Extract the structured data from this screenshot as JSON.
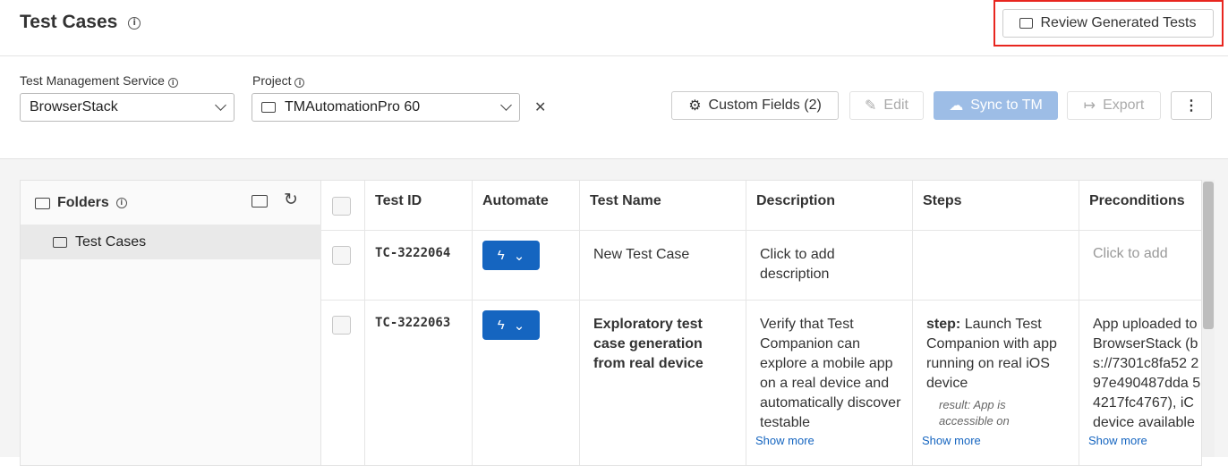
{
  "header": {
    "title": "Test Cases",
    "info_icon": "i",
    "review_button": "Review Generated Tests"
  },
  "filters": {
    "service_label": "Test Management Service",
    "service_value": "BrowserStack",
    "project_label": "Project",
    "project_value": "TMAutomationPro 60",
    "clear": "✕"
  },
  "toolbar": {
    "custom_fields": "Custom Fields (2)",
    "edit": "Edit",
    "sync": "Sync to TM",
    "export": "Export",
    "more": "⋮"
  },
  "folders": {
    "title": "Folders",
    "items": [
      "Test Cases"
    ]
  },
  "table": {
    "columns": [
      "Test ID",
      "Automate",
      "Test Name",
      "Description",
      "Steps",
      "Preconditions"
    ],
    "rows": [
      {
        "id": "TC-3222064",
        "name": "New Test Case",
        "description": "Click to add description",
        "steps": "",
        "steps_label": "",
        "steps_result": "",
        "preconditions": "Click to add"
      },
      {
        "id": "TC-3222063",
        "name": "Exploratory test case generation from real device",
        "description": "Verify that Test Companion can explore a mobile app on a real device and automatically discover testable",
        "steps_label": "step:",
        "steps": "Launch Test Companion with app running on real iOS device",
        "steps_result": "result: App is accessible on",
        "preconditions": "App uploaded to BrowserStack (bs://7301c8fa52 297e490487dda 54217fc4767), iC device available",
        "show_more": "Show more"
      }
    ]
  }
}
